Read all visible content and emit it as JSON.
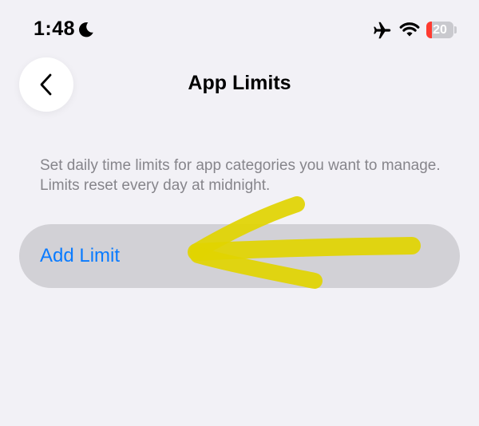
{
  "status_bar": {
    "time": "1:48",
    "battery_level": "20",
    "battery_fraction": 0.2,
    "icons": [
      "moon-icon",
      "airplane-icon",
      "wifi-icon",
      "battery-icon"
    ],
    "battery_color": "#ff3b30"
  },
  "header": {
    "back_icon": "chevron-left-icon",
    "title": "App Limits"
  },
  "main": {
    "description": "Set daily time limits for app categories you want to manage. Limits reset every day at midnight.",
    "add_limit_label": "Add Limit"
  },
  "annotation": {
    "type": "hand-drawn-arrow",
    "color": "#e1d400"
  },
  "colors": {
    "background": "#f2f1f6",
    "accent": "#0a7bff",
    "row_background": "#d2d1d6",
    "secondary_text": "#86858b"
  }
}
